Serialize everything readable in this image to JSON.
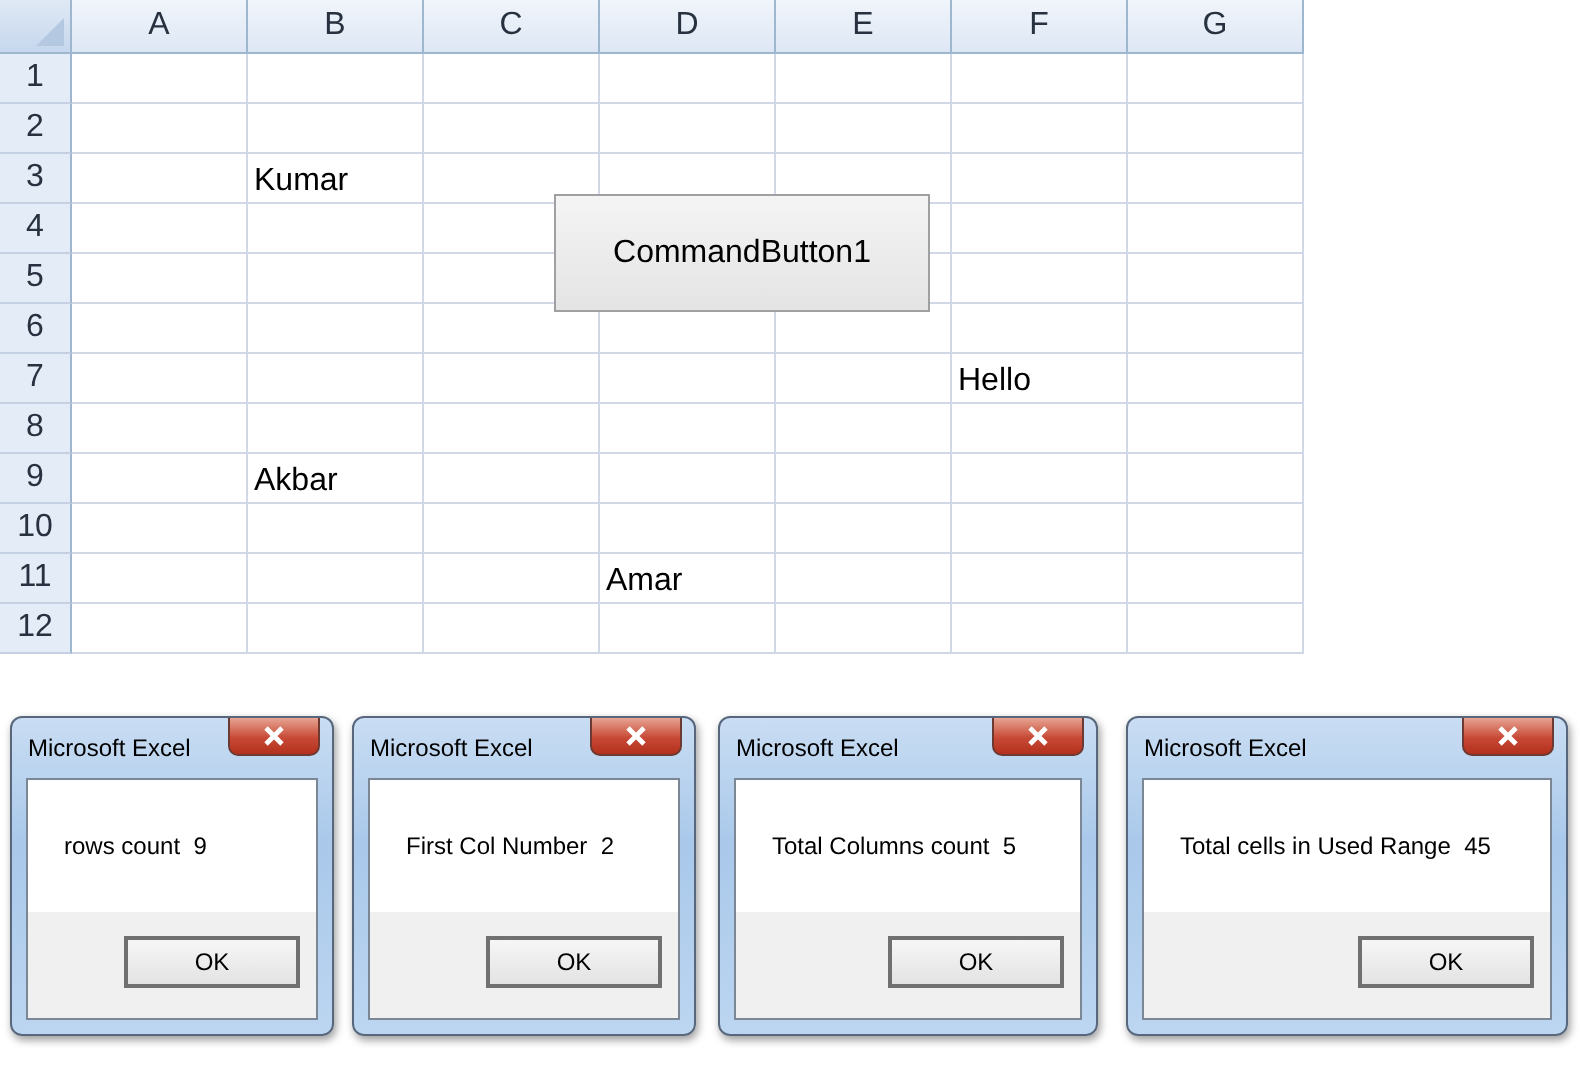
{
  "sheet": {
    "columns": [
      "A",
      "B",
      "C",
      "D",
      "E",
      "F",
      "G"
    ],
    "rows": [
      {
        "number": "1",
        "cells": [
          null,
          null,
          null,
          null,
          null,
          null,
          null
        ]
      },
      {
        "number": "2",
        "cells": [
          null,
          null,
          null,
          null,
          null,
          null,
          null
        ]
      },
      {
        "number": "3",
        "cells": [
          null,
          "Kumar",
          null,
          null,
          null,
          null,
          null
        ]
      },
      {
        "number": "4",
        "cells": [
          null,
          null,
          null,
          null,
          null,
          null,
          null
        ]
      },
      {
        "number": "5",
        "cells": [
          null,
          null,
          null,
          null,
          null,
          null,
          null
        ]
      },
      {
        "number": "6",
        "cells": [
          null,
          null,
          null,
          null,
          null,
          null,
          null
        ]
      },
      {
        "number": "7",
        "cells": [
          null,
          null,
          null,
          null,
          null,
          "Hello",
          null
        ]
      },
      {
        "number": "8",
        "cells": [
          null,
          null,
          null,
          null,
          null,
          null,
          null
        ]
      },
      {
        "number": "9",
        "cells": [
          null,
          "Akbar",
          null,
          null,
          null,
          null,
          null
        ]
      },
      {
        "number": "10",
        "cells": [
          null,
          null,
          null,
          null,
          null,
          null,
          null
        ]
      },
      {
        "number": "11",
        "cells": [
          null,
          null,
          null,
          "Amar",
          null,
          null,
          null
        ]
      },
      {
        "number": "12",
        "cells": [
          null,
          null,
          null,
          null,
          null,
          null,
          null
        ]
      }
    ],
    "command_button": "CommandButton1"
  },
  "dialogs": [
    {
      "title": "Microsoft Excel",
      "message": "rows count  9",
      "button": "OK"
    },
    {
      "title": "Microsoft Excel",
      "message": "First Col Number  2",
      "button": "OK"
    },
    {
      "title": "Microsoft Excel",
      "message": "Total Columns count  5",
      "button": "OK"
    },
    {
      "title": "Microsoft Excel",
      "message": "Total cells in Used Range  45",
      "button": "OK"
    }
  ]
}
